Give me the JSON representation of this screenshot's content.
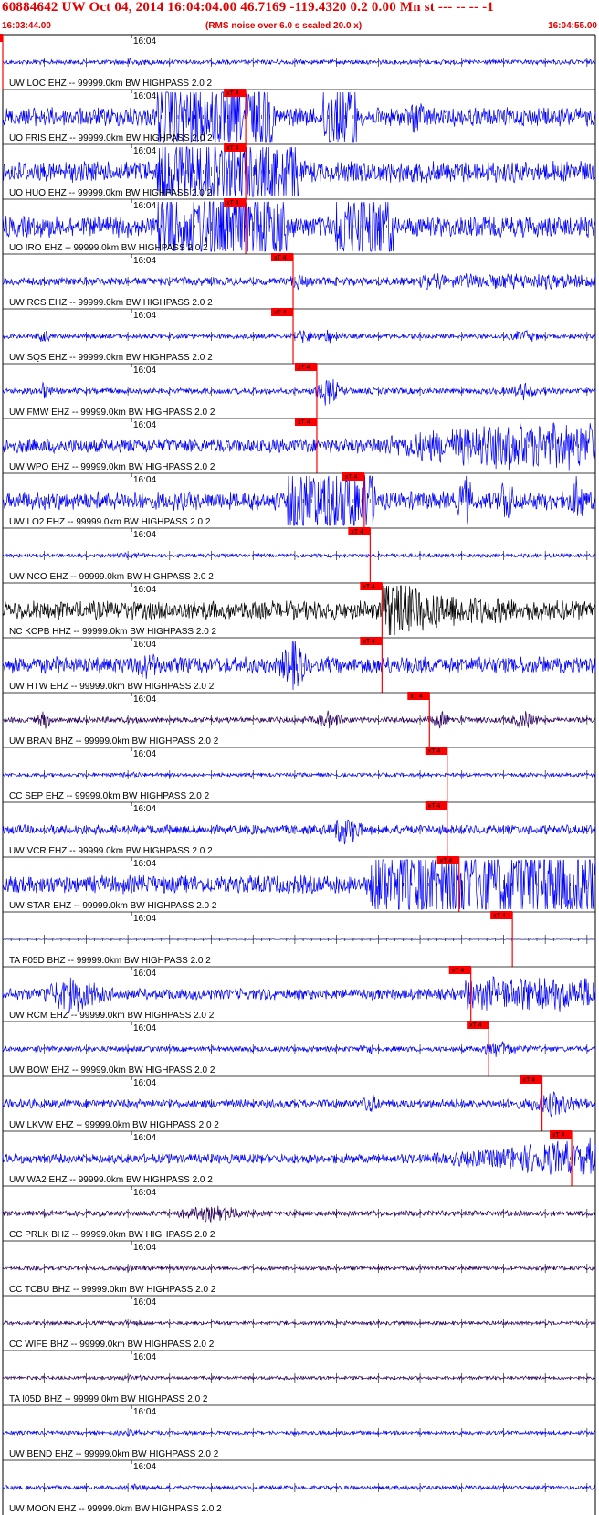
{
  "header": {
    "title": "60884642 UW Oct 04, 2014 16:04:04.00   46.7169 -119.4320  0.2 0.00 Mn st --- -- --  -1",
    "start_time": "16:03:44.00",
    "noise_note": "(RMS noise over 6.0 s scaled 20.0 x)",
    "end_time": "16:04:55.00"
  },
  "minute_label": "16:04",
  "pick_label": "xT 4",
  "colors": {
    "trace_blue": "#0000ff",
    "trace_black": "#000000",
    "trace_purple": "#2a0060",
    "pick_red": "#ff0000",
    "header_red": "#e00000"
  },
  "traces": [
    {
      "label": "UW LOC EHZ -- 99999.0km BW  HIGHPASS  2.0  2",
      "pick": 0.0,
      "color": "blue",
      "amp": 0.25,
      "style": "quiet"
    },
    {
      "label": "UO FRIS EHZ -- 99999.0km BW  HIGHPASS  2.0  2",
      "pick": 0.41,
      "color": "blue",
      "amp": 1.0,
      "style": "clipped_bursts"
    },
    {
      "label": "UO HUO EHZ -- 99999.0km BW  HIGHPASS  2.0  2",
      "pick": 0.41,
      "color": "blue",
      "amp": 1.0,
      "style": "clipped"
    },
    {
      "label": "UO IRO EHZ -- 99999.0km BW  HIGHPASS  2.0  2",
      "pick": 0.41,
      "color": "blue",
      "amp": 1.0,
      "style": "clipped_late"
    },
    {
      "label": "UW RCS EHZ -- 99999.0km BW  HIGHPASS  2.0  2",
      "pick": 0.49,
      "color": "blue",
      "amp": 0.45,
      "style": "growing"
    },
    {
      "label": "UW SQS EHZ -- 99999.0km BW  HIGHPASS  2.0  2",
      "pick": 0.49,
      "color": "blue",
      "amp": 0.35,
      "style": "bursts"
    },
    {
      "label": "UW FMW EHZ -- 99999.0km BW  HIGHPASS  2.0  2",
      "pick": 0.53,
      "color": "blue",
      "amp": 0.45,
      "style": "bursts"
    },
    {
      "label": "UW WPO EHZ -- 99999.0km BW  HIGHPASS  2.0  2",
      "pick": 0.53,
      "color": "blue",
      "amp": 0.9,
      "style": "late_big"
    },
    {
      "label": "UW LO2 EHZ -- 99999.0km BW  HIGHPASS  2.0  2",
      "pick": 0.61,
      "color": "blue",
      "amp": 1.0,
      "style": "block"
    },
    {
      "label": "UW NCO EHZ -- 99999.0km BW  HIGHPASS  2.0  2",
      "pick": 0.62,
      "color": "blue",
      "amp": 0.2,
      "style": "quiet"
    },
    {
      "label": "NC KCPB HHZ -- 99999.0km BW  HIGHPASS  2.0  2",
      "pick": 0.64,
      "color": "black",
      "amp": 1.0,
      "style": "quake"
    },
    {
      "label": "UW HTW EHZ -- 99999.0km BW  HIGHPASS  2.0  2",
      "pick": 0.64,
      "color": "blue",
      "amp": 0.9,
      "style": "quake_mid"
    },
    {
      "label": "UW BRAN BHZ -- 99999.0km BW  HIGHPASS  2.0  2",
      "pick": 0.72,
      "color": "purple",
      "amp": 0.45,
      "style": "bursts"
    },
    {
      "label": "CC SEP EHZ -- 99999.0km BW  HIGHPASS  2.0  2",
      "pick": 0.75,
      "color": "blue",
      "amp": 0.2,
      "style": "quiet"
    },
    {
      "label": "UW VCR EHZ -- 99999.0km BW  HIGHPASS  2.0  2",
      "pick": 0.75,
      "color": "blue",
      "amp": 0.5,
      "style": "quake_small"
    },
    {
      "label": "UW STAR EHZ -- 99999.0km BW  HIGHPASS  2.0  2",
      "pick": 0.77,
      "color": "blue",
      "amp": 1.0,
      "style": "block_long"
    },
    {
      "label": "TA F05D BHZ -- 99999.0km BW  HIGHPASS  2.0  2",
      "pick": 0.86,
      "color": "navy",
      "amp": 0.05,
      "style": "flat"
    },
    {
      "label": "UW RCM EHZ -- 99999.0km BW  HIGHPASS  2.0  2",
      "pick": 0.79,
      "color": "blue",
      "amp": 0.6,
      "style": "early_burst"
    },
    {
      "label": "UW BOW EHZ -- 99999.0km BW  HIGHPASS  2.0  2",
      "pick": 0.82,
      "color": "blue",
      "amp": 0.35,
      "style": "late_small"
    },
    {
      "label": "UW LKVW EHZ -- 99999.0km BW  HIGHPASS  2.0  2",
      "pick": 0.91,
      "color": "blue",
      "amp": 0.55,
      "style": "late_small"
    },
    {
      "label": "UW WA2 EHZ -- 99999.0km BW  HIGHPASS  2.0  2",
      "pick": 0.96,
      "color": "blue",
      "amp": 0.6,
      "style": "ramp"
    },
    {
      "label": "CC PRLK BHZ -- 99999.0km BW  HIGHPASS  2.0  2",
      "pick": -1,
      "color": "purple",
      "amp": 0.35,
      "style": "mid_burst"
    },
    {
      "label": "CC TCBU BHZ -- 99999.0km BW  HIGHPASS  2.0  2",
      "pick": -1,
      "color": "purple",
      "amp": 0.22,
      "style": "quiet"
    },
    {
      "label": "CC WIFE BHZ -- 99999.0km BW  HIGHPASS  2.0  2",
      "pick": -1,
      "color": "purple",
      "amp": 0.2,
      "style": "quiet"
    },
    {
      "label": "TA I05D BHZ -- 99999.0km BW  HIGHPASS  2.0  2",
      "pick": -1,
      "color": "purple",
      "amp": 0.18,
      "style": "quiet"
    },
    {
      "label": "UW BEND EHZ -- 99999.0km BW  HIGHPASS  2.0  2",
      "pick": -1,
      "color": "blue",
      "amp": 0.2,
      "style": "quiet"
    },
    {
      "label": "UW MOON EHZ -- 99999.0km BW  HIGHPASS  2.0  2",
      "pick": -1,
      "color": "blue",
      "amp": 0.22,
      "style": "quiet"
    }
  ]
}
